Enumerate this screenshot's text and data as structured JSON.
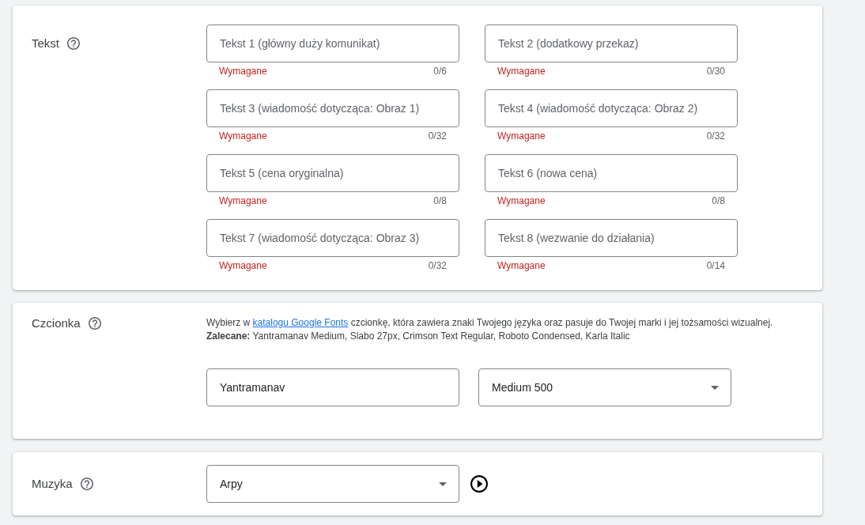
{
  "text_section": {
    "label": "Tekst",
    "fields": [
      {
        "placeholder": "Tekst 1 (główny duży komunikat)",
        "hint": "Wymagane",
        "counter": "0/6"
      },
      {
        "placeholder": "Tekst 2 (dodatkowy przekaz)",
        "hint": "Wymagane",
        "counter": "0/30"
      },
      {
        "placeholder": "Tekst 3 (wiadomość dotycząca: Obraz 1)",
        "hint": "Wymagane",
        "counter": "0/32"
      },
      {
        "placeholder": "Tekst 4 (wiadomość dotycząca: Obraz 2)",
        "hint": "Wymagane",
        "counter": "0/32"
      },
      {
        "placeholder": "Tekst 5 (cena oryginalna)",
        "hint": "Wymagane",
        "counter": "0/8"
      },
      {
        "placeholder": "Tekst 6 (nowa cena)",
        "hint": "Wymagane",
        "counter": "0/8"
      },
      {
        "placeholder": "Tekst 7 (wiadomość dotycząca: Obraz 3)",
        "hint": "Wymagane",
        "counter": "0/32"
      },
      {
        "placeholder": "Tekst 8 (wezwanie do działania)",
        "hint": "Wymagane",
        "counter": "0/14"
      }
    ]
  },
  "font_section": {
    "label": "Czcionka",
    "description": {
      "before": "Wybierz w",
      "link": "katalogu Google Fonts",
      "after": "czcionkę, która zawiera znaki Twojego języka oraz pasuje do Twojej marki i jej tożsamości wizualnej."
    },
    "recommended": "**Zalecane:** Yantramanav Medium, Slabo 27px, Crimson Text Regular, Roboto Condensed, Karla Italic",
    "family": {
      "value": "Yantramanav"
    },
    "weight": {
      "value": "Medium 500"
    }
  },
  "music_section": {
    "label": "Muzyka",
    "track": {
      "value": "Arpy"
    }
  }
}
